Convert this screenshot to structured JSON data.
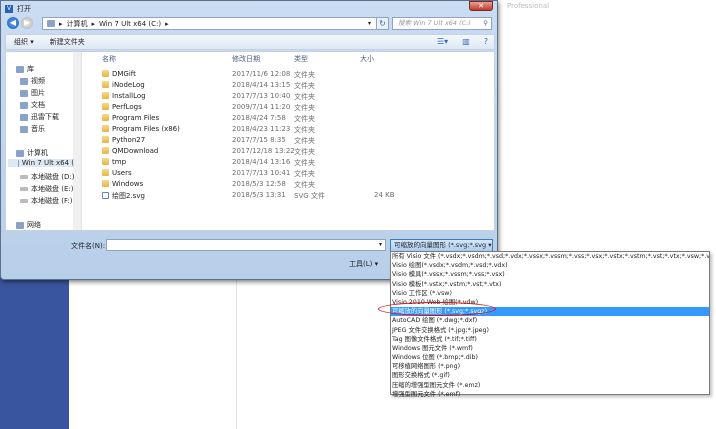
{
  "window": {
    "title": "打开",
    "close": "✕",
    "app_icon": "V",
    "watermark": "Professional"
  },
  "address": {
    "crumbs": [
      "计算机",
      "Win 7 Ult x64 (C:)"
    ],
    "search_placeholder": "搜索 Win 7 Ult x64 (C:)"
  },
  "toolbar": {
    "organize": "组织 ▾",
    "new_folder": "新建文件夹"
  },
  "nav": [
    {
      "label": "库",
      "icon": "library-icon"
    },
    {
      "label": "视频",
      "icon": "video-icon"
    },
    {
      "label": "图片",
      "icon": "picture-icon"
    },
    {
      "label": "文档",
      "icon": "document-icon"
    },
    {
      "label": "迅雷下载",
      "icon": "download-icon"
    },
    {
      "label": "音乐",
      "icon": "music-icon"
    },
    {
      "label": "计算机",
      "icon": "computer-icon"
    },
    {
      "label": "Win 7 Ult x64 (",
      "icon": "drive-icon"
    },
    {
      "label": "本地磁盘 (D:)",
      "icon": "drive-icon"
    },
    {
      "label": "本地磁盘 (E:)",
      "icon": "drive-icon"
    },
    {
      "label": "本地磁盘 (F:)",
      "icon": "drive-icon"
    },
    {
      "label": "网络",
      "icon": "network-icon"
    }
  ],
  "columns": [
    "名称",
    "修改日期",
    "类型",
    "大小"
  ],
  "files": [
    {
      "name": "DMGift",
      "date": "2017/11/6 12:08",
      "type": "文件夹",
      "size": ""
    },
    {
      "name": "iNodeLog",
      "date": "2018/4/14 13:15",
      "type": "文件夹",
      "size": ""
    },
    {
      "name": "InstallLog",
      "date": "2017/7/13 10:40",
      "type": "文件夹",
      "size": ""
    },
    {
      "name": "PerfLogs",
      "date": "2009/7/14 11:20",
      "type": "文件夹",
      "size": ""
    },
    {
      "name": "Program Files",
      "date": "2018/4/24 7:58",
      "type": "文件夹",
      "size": ""
    },
    {
      "name": "Program Files (x86)",
      "date": "2018/4/23 11:23",
      "type": "文件夹",
      "size": ""
    },
    {
      "name": "Python27",
      "date": "2017/7/15 8:35",
      "type": "文件夹",
      "size": ""
    },
    {
      "name": "QMDownload",
      "date": "2017/12/18 13:22",
      "type": "文件夹",
      "size": ""
    },
    {
      "name": "tmp",
      "date": "2018/4/14 13:16",
      "type": "文件夹",
      "size": ""
    },
    {
      "name": "Users",
      "date": "2017/7/13 10:41",
      "type": "文件夹",
      "size": ""
    },
    {
      "name": "Windows",
      "date": "2018/5/3 12:58",
      "type": "文件夹",
      "size": ""
    },
    {
      "name": "绘图2.svg",
      "date": "2018/5/3 13:31",
      "type": "SVG 文件",
      "size": "24 KB"
    }
  ],
  "footer": {
    "filename_label": "文件名(N):",
    "filename_value": "",
    "filetype_selected": "可缩放的向量图形 (*.svg;*.svg ▾",
    "tools": "工具(L)  ▾"
  },
  "filetype_options": [
    "所有 Visio 文件 (*.vsdx;*.vsdm;*.vsd;*.vdx;*.vssx;*.vssm;*.vss;*.vsx;*.vstx;*.vstm;*.vst;*.vtx;*.vsw;*.vdw)",
    "Visio 绘图(*.vsdx;*.vsdm;*.vsd;*.vdx)",
    "Visio 模具(*.vssx;*.vssm;*.vss;*.vsx)",
    "Visio 模板(*.vstx;*.vstm;*.vst;*.vtx)",
    "Visio 工作区 (*.vsw)",
    "Visio 2010 Web 绘图(*.vdw)",
    "可缩放的向量图形 (*.svg;*.svgz)",
    "AutoCAD 绘图 (*.dwg;*.dxf)",
    "JPEG 文件交换格式 (*.jpg;*.jpeg)",
    "Tag 图像文件格式 (*.tif;*.tiff)",
    "Windows 图元文件 (*.wmf)",
    "Windows 位图 (*.bmp;*.dib)",
    "可移植网络图形 (*.png)",
    "图形交换格式 (*.gif)",
    "压缩的增强型图元文件 (*.emz)",
    "增强型图元文件 (*.emf)"
  ],
  "selected_option_index": 6
}
